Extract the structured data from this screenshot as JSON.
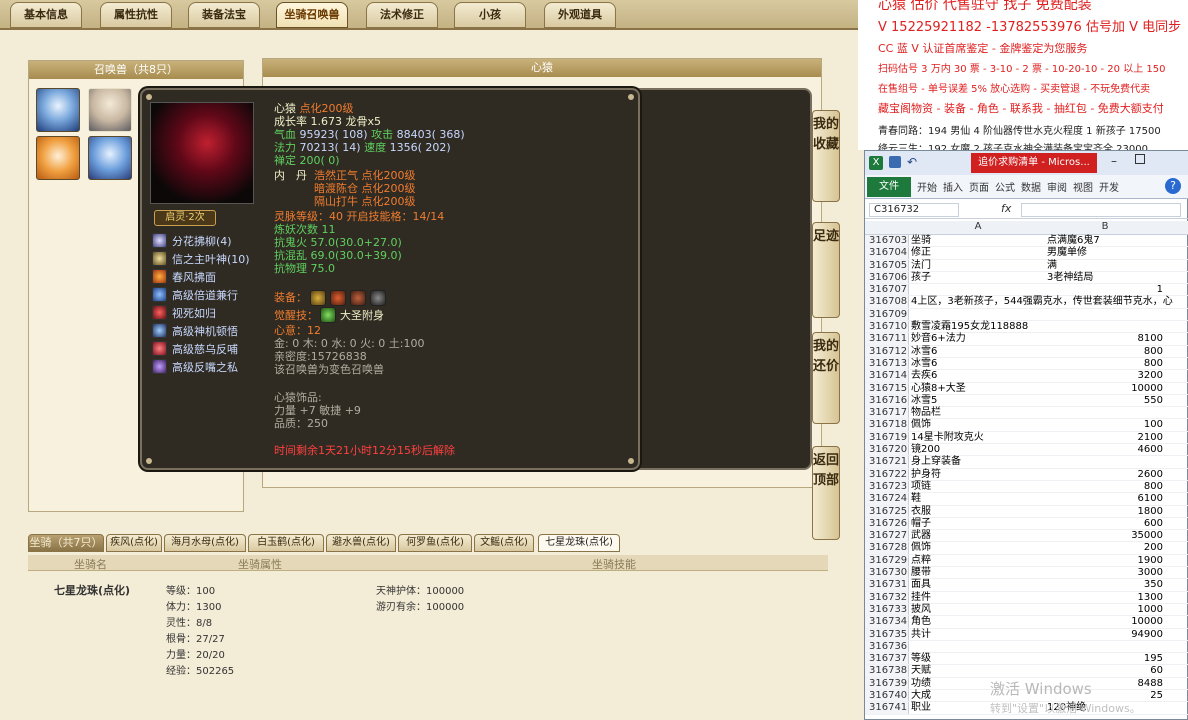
{
  "game": {
    "tabs": [
      "基本信息",
      "属性抗性",
      "装备法宝",
      "坐骑召唤兽",
      "法术修正",
      "小孩",
      "外观道具"
    ],
    "active_tab": 3,
    "summon_panel_title": "召唤兽（共8只）",
    "detail_panel_title": "心猿",
    "popup": {
      "name": "心猿",
      "name_suffix": "点化200级",
      "growth": "成长率 1.673 龙骨x5",
      "hp_label": "气血",
      "hp": "95923( 108)",
      "atk_label": "攻击",
      "atk": "88403( 368)",
      "mp_label": "法力",
      "mp": "70213( 14)",
      "spd_label": "速度",
      "spd": "1356( 202)",
      "zen": "禅定 200( 0)",
      "inner_label": "内　丹",
      "inner_1": "浩然正气 点化200级",
      "inner_2": "暗渡陈仓 点化200级",
      "inner_3": "隔山打牛 点化200级",
      "spirit": "灵脉等级：40 开启技能格：14/14",
      "refine": "炼妖次数 11",
      "res_1": "抗鬼火 57.0(30.0+27.0)",
      "res_2": "抗混乱 69.0(30.0+39.0)",
      "res_3": "抗物理 75.0",
      "equip_label": "装备：",
      "awaken_label": "觉醒技：",
      "awaken_skill": "大圣附身",
      "heart": "心意：12",
      "elements": "金: 0 木: 0 水: 0 火: 0 土:100",
      "intimacy": "亲密度:15726838",
      "variant": "该召唤兽为变色召唤兽",
      "deco_title": "心猿饰品:",
      "deco_stats": "力量 +7 敏捷 +9",
      "quality": "品质：250",
      "timer": "时间剩余1天21小时12分15秒后解除",
      "badge": "启灵·2次",
      "skills": [
        "分花拂柳(4)",
        "信之主叶神(10)",
        "春风拂面",
        "高级倍道兼行",
        "视死如归",
        "高级神机顿悟",
        "高级慈乌反哺",
        "高级反嘴之私"
      ]
    },
    "side_buttons": [
      "我的收藏",
      "足迹",
      "我的还价",
      "返回顶部"
    ],
    "mount": {
      "tab_label": "坐骑（共7只）",
      "tabs": [
        "疾风(点化)",
        "海月水母(点化)",
        "白玉鹤(点化)",
        "避水兽(点化)",
        "何罗鱼(点化)",
        "文鳐(点化)",
        "七星龙珠(点化)"
      ],
      "head_name": "坐骑名",
      "head_attr": "坐骑属性",
      "head_skill": "坐骑技能",
      "name": "七星龙珠(点化)",
      "attrs": [
        "等级：100",
        "体力：1300",
        "灵性：8/8",
        "根骨：27/27",
        "力量：20/20",
        "经验：502265"
      ],
      "skills": [
        "天神护体：100000",
        "游刃有余：100000"
      ]
    }
  },
  "chat": {
    "line0": "心猿 估价 代售驻守 找子 免费配装",
    "line1": "V 15225921182 -13782553976 估号加 V 电同步",
    "line2": "CC 蓝 V 认证首席鉴定 - 金牌鉴定为您服务",
    "line3": "扫码估号 3 万内 30 票 - 3-10 - 2 票 - 10-20-10 - 20 以上 150",
    "line4": "在售组号 - 单号误差 5% 放心选购 - 买卖管退 - 不玩免费代卖",
    "line5": "藏宝阁物资 - 装备 - 角色 - 联系我 - 抽红包 - 免费大额支付",
    "line6": "青春同路：194 男仙 4 阶仙器传世水克火程度 1 新孩子 17500",
    "line7": "绛云三生：192 女魔 2 孩子克水神全满装备宝宝齐全 23000"
  },
  "excel": {
    "title": "追价求购清单 - Micros...",
    "ribbon": [
      "文件",
      "开始",
      "插入",
      "页面",
      "公式",
      "数据",
      "审阅",
      "视图",
      "开发"
    ],
    "cell_ref": "C316732",
    "fx": "fx",
    "col_a": "A",
    "col_b": "B",
    "rows": [
      [
        "316703",
        "坐骑",
        "点满魔6鬼7",
        false
      ],
      [
        "316704",
        "修正",
        "男魔单修",
        false
      ],
      [
        "316705",
        "法门",
        "满",
        false
      ],
      [
        "316706",
        "孩子",
        "3老神结局",
        false
      ],
      [
        "316707",
        "",
        "1",
        true
      ],
      [
        "316708",
        "4上区，3老新孩子，544强霸克水，传世套装细节克水，心",
        "",
        false
      ],
      [
        "316709",
        "",
        "",
        false
      ],
      [
        "316710",
        "敷雪凌霜195女龙118888",
        "",
        false
      ],
      [
        "316711",
        "妙音6+法力",
        "8100",
        true
      ],
      [
        "316712",
        "冰雪6",
        "800",
        true
      ],
      [
        "316713",
        "冰雪6",
        "800",
        true
      ],
      [
        "316714",
        "去疾6",
        "3200",
        true
      ],
      [
        "316715",
        "心猿8+大圣",
        "10000",
        true
      ],
      [
        "316716",
        "冰雪5",
        "550",
        true
      ],
      [
        "316717",
        "物品栏",
        "",
        false
      ],
      [
        "316718",
        "佩饰",
        "100",
        true
      ],
      [
        "316719",
        "14星卡附攻克火",
        "2100",
        true
      ],
      [
        "316720",
        "镜200",
        "4600",
        true
      ],
      [
        "316721",
        "身上穿装备",
        "",
        false
      ],
      [
        "316722",
        "护身符",
        "2600",
        true
      ],
      [
        "316723",
        "项链",
        "800",
        true
      ],
      [
        "316724",
        "鞋",
        "6100",
        true
      ],
      [
        "316725",
        "衣服",
        "1800",
        true
      ],
      [
        "316726",
        "帽子",
        "600",
        true
      ],
      [
        "316727",
        "武器",
        "35000",
        true
      ],
      [
        "316728",
        "佩饰",
        "200",
        true
      ],
      [
        "316729",
        "点粹",
        "1900",
        true
      ],
      [
        "316730",
        "腰带",
        "3000",
        true
      ],
      [
        "316731",
        "面具",
        "350",
        true
      ],
      [
        "316732",
        "挂件",
        "1300",
        true
      ],
      [
        "316733",
        "披风",
        "1000",
        true
      ],
      [
        "316734",
        "角色",
        "10000",
        true
      ],
      [
        "316735",
        "共计",
        "94900",
        true
      ],
      [
        "316736",
        "",
        "",
        false
      ],
      [
        "316737",
        "等级",
        "195",
        true
      ],
      [
        "316738",
        "天赋",
        "60",
        true
      ],
      [
        "316739",
        "功绩",
        "8488",
        true
      ],
      [
        "316740",
        "大成",
        "25",
        true
      ],
      [
        "316741",
        "职业",
        "120神绝",
        false
      ]
    ]
  },
  "watermark": {
    "line1": "激活 Windows",
    "line2": "转到\"设置\"以激活 Windows。"
  }
}
